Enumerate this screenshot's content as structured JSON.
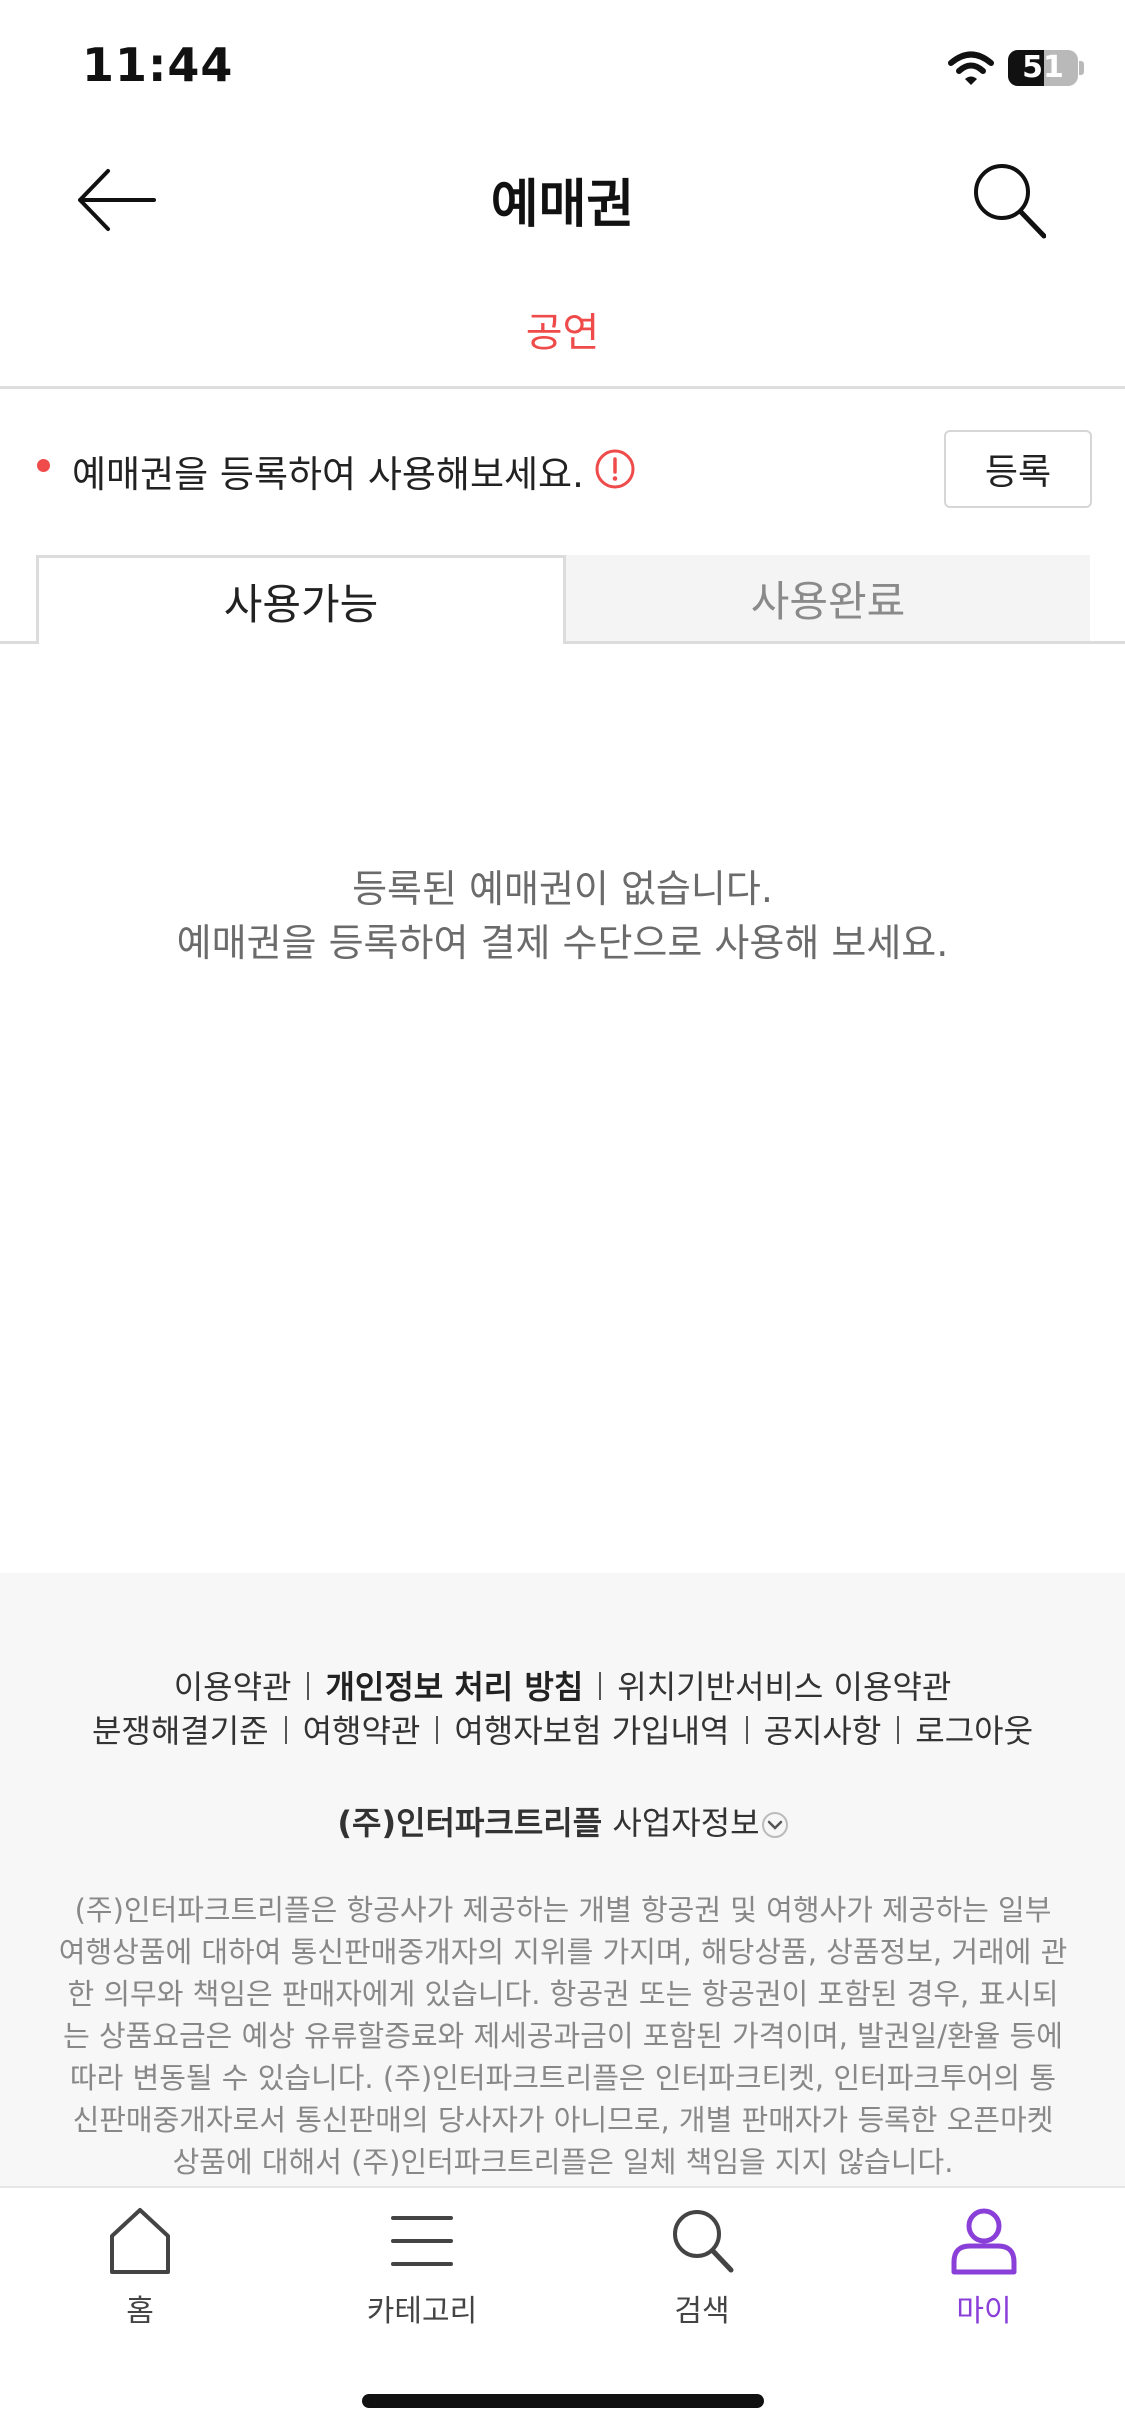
{
  "status_bar": {
    "time": "11:44",
    "battery": "51",
    "battery_level": 0.51
  },
  "header": {
    "title": "예매권",
    "category_tab": "공연"
  },
  "notice": {
    "text": "예매권을 등록하여 사용해보세요.",
    "register_label": "등록"
  },
  "tabs": [
    {
      "label": "사용가능",
      "active": true
    },
    {
      "label": "사용완료",
      "active": false
    }
  ],
  "empty_state": {
    "line1": "등록된 예매권이 없습니다.",
    "line2": "예매권을 등록하여 결제 수단으로 사용해 보세요."
  },
  "footer": {
    "links_row1": [
      "이용약관",
      "개인정보 처리 방침",
      "위치기반서비스 이용약관"
    ],
    "links_row2": [
      "분쟁해결기준",
      "여행약관",
      "여행자보험 가입내역",
      "공지사항",
      "로그아웃"
    ],
    "company_name": "(주)인터파크트리플",
    "company_info_label": "사업자정보",
    "disclaimer": "(주)인터파크트리플은 항공사가 제공하는 개별 항공권 및 여행사가 제공하는 일부 여행상품에 대하여 통신판매중개자의 지위를 가지며, 해당상품, 상품정보, 거래에 관한 의무와 책임은 판매자에게 있습니다. 항공권 또는 항공권이 포함된 경우, 표시되는 상품요금은 예상 유류할증료와 제세공과금이 포함된 가격이며, 발권일/환율 등에 따라 변동될 수 있습니다. (주)인터파크트리플은 인터파크티켓, 인터파크투어의 통신판매중개자로서 통신판매의 당사자가 아니므로, 개별 판매자가 등록한 오픈마켓 상품에 대해서 (주)인터파크트리플은 일체 책임을 지지 않습니다."
  },
  "bottom_nav": [
    {
      "label": "홈",
      "icon": "home-icon"
    },
    {
      "label": "카테고리",
      "icon": "menu-icon"
    },
    {
      "label": "검색",
      "icon": "search-icon"
    },
    {
      "label": "마이",
      "icon": "person-icon",
      "active": true
    }
  ],
  "colors": {
    "accent_red": "#ef4b4b",
    "active_purple": "#8a3fd8"
  }
}
